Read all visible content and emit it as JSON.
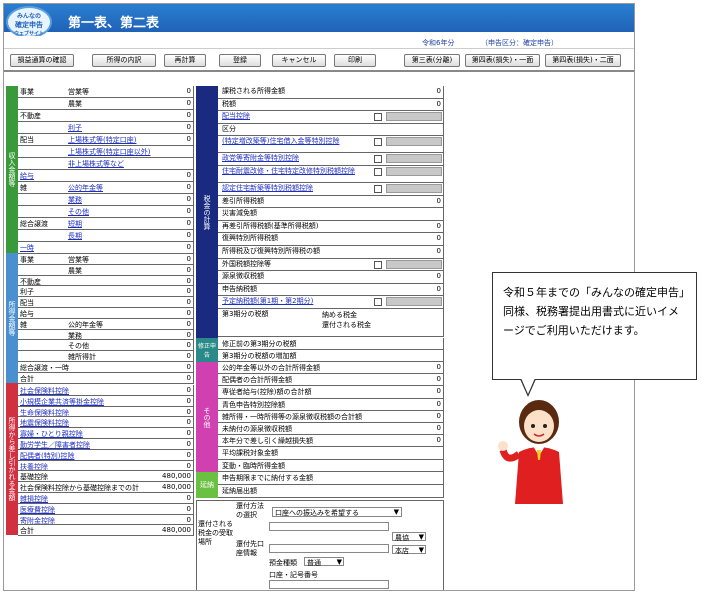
{
  "app": {
    "logo_line1": "みんなの",
    "logo_line2": "確定申告",
    "logo_line3": "ウェブサイト",
    "title": "第一表、第二表",
    "era": "令和6年分",
    "kubun": "（申告区分：確定申告）"
  },
  "toolbar": [
    "損益通算の確認",
    "所得の内訳",
    "再計算",
    "登録",
    "キャンセル",
    "印刷"
  ],
  "toolbar_right": [
    "第三表(分離)",
    "第四表(損失)・一面",
    "第四表(損失)・二面"
  ],
  "categories": {
    "income": "収入金額等",
    "shotoku": "所得金額等",
    "deduct": "所得から差し引かれる金額",
    "tax": "税金の計算",
    "shusei": "修正申告",
    "sonota": "その他",
    "enno": "延納"
  },
  "left_rows": [
    {
      "g": "事業",
      "l": "営業等",
      "v": "0"
    },
    {
      "g": "",
      "l": "農業",
      "v": "0"
    },
    {
      "g": "不動産",
      "l": "",
      "v": "0"
    },
    {
      "g": "",
      "l": "利子",
      "v": "0",
      "link": true
    },
    {
      "g": "配当",
      "l": "上場株式等(特定口座)",
      "v": "0",
      "link": true
    },
    {
      "g": "",
      "l": "上場株式等(特定口座以外)",
      "v": "",
      "link": true
    },
    {
      "g": "",
      "l": "非上場株式等など",
      "v": "",
      "link": true
    },
    {
      "g": "給与",
      "l": "",
      "v": "0",
      "link": true
    },
    {
      "g": "雑",
      "l": "公的年金等",
      "v": "0",
      "link": true
    },
    {
      "g": "",
      "l": "業務",
      "v": "0",
      "link": true
    },
    {
      "g": "",
      "l": "その他",
      "v": "0",
      "link": true
    },
    {
      "g": "総合譲渡",
      "l": "短期",
      "v": "0",
      "link": true
    },
    {
      "g": "",
      "l": "長期",
      "v": "0",
      "link": true
    },
    {
      "g": "一時",
      "l": "",
      "v": "0",
      "link": true
    }
  ],
  "left_rows2": [
    {
      "g": "事業",
      "l": "営業等",
      "v": "0"
    },
    {
      "g": "",
      "l": "農業",
      "v": "0"
    },
    {
      "g": "不動産",
      "l": "",
      "v": "0"
    },
    {
      "g": "利子",
      "l": "",
      "v": "0"
    },
    {
      "g": "配当",
      "l": "",
      "v": "0"
    },
    {
      "g": "給与",
      "l": "",
      "v": "0"
    },
    {
      "g": "雑",
      "l": "公的年金等",
      "v": "0"
    },
    {
      "g": "",
      "l": "業務",
      "v": "0"
    },
    {
      "g": "",
      "l": "その他",
      "v": "0"
    },
    {
      "g": "",
      "l": "雑所得計",
      "v": "0"
    },
    {
      "g": "総合譲渡・一時",
      "l": "",
      "v": "0"
    },
    {
      "g": "合計",
      "l": "",
      "v": "0"
    }
  ],
  "deduct_rows": [
    {
      "l": "社会保険料控除",
      "v": "0"
    },
    {
      "l": "小規模企業共済等掛金控除",
      "v": "0"
    },
    {
      "l": "生命保険料控除",
      "v": "0"
    },
    {
      "l": "地震保険料控除",
      "v": "0"
    },
    {
      "l": "寡婦・ひとり親控除",
      "v": "0"
    },
    {
      "l": "勤労学生／障害者控除",
      "v": "0"
    },
    {
      "l": "配偶者(特別)控除",
      "v": "0"
    },
    {
      "l": "扶養控除",
      "v": "0"
    },
    {
      "l": "基礎控除",
      "v": "480,000"
    },
    {
      "l": "社会保険料控除から基礎控除までの計",
      "v": "480,000"
    },
    {
      "l": "雑損控除",
      "v": "0"
    },
    {
      "l": "医療費控除",
      "v": "0"
    },
    {
      "l": "寄附金控除",
      "v": "0"
    },
    {
      "l": "合計",
      "v": "480,000"
    }
  ],
  "tax_rows": [
    {
      "l": "課税される所得金額",
      "v": "0"
    },
    {
      "l": "税額",
      "v": "0"
    },
    {
      "l": "配当控除",
      "v": "0"
    },
    {
      "l": "区分",
      "v": ""
    },
    {
      "l": "(特定増改築等)住宅借入金等特別控除",
      "v": ""
    },
    {
      "l": "政党等寄附金等特別控除",
      "v": ""
    },
    {
      "l": "住宅耐震改修・住宅特定改修特別税額控除",
      "v": ""
    },
    {
      "l": "認定住宅新築等特別税額控除",
      "v": ""
    },
    {
      "l": "差引所得税額",
      "v": "0"
    },
    {
      "l": "災害減免額",
      "v": ""
    },
    {
      "l": "再差引所得税額(基準所得税額)",
      "v": "0"
    },
    {
      "l": "復興特別所得税額",
      "v": "0"
    },
    {
      "l": "所得税及び復興特別所得税の額",
      "v": "0"
    },
    {
      "l": "外国税額控除等",
      "v": ""
    },
    {
      "l": "源泉徴収税額",
      "v": "0"
    },
    {
      "l": "申告納税額",
      "v": "0"
    },
    {
      "l": "予定納税額(第1期・第2期分)",
      "v": ""
    },
    {
      "l": "第3期分の税額",
      "v": ""
    }
  ],
  "nofu": "納める税金",
  "kanpu": "還付される税金",
  "shusei_rows": [
    {
      "l": "修正前の第3期分の税額",
      "v": ""
    },
    {
      "l": "第3期分の税額の増加額",
      "v": ""
    }
  ],
  "sonota_rows": [
    {
      "l": "公的年金等以外の合計所得金額",
      "v": "0"
    },
    {
      "l": "配偶者の合計所得金額",
      "v": "0"
    },
    {
      "l": "専従者給与(控除)額の合計額",
      "v": "0"
    },
    {
      "l": "青色申告特別控除額",
      "v": "0"
    },
    {
      "l": "雑所得・一時所得等の源泉徴収税額の合計額",
      "v": "0"
    },
    {
      "l": "未納付の源泉徴収税額",
      "v": "0"
    },
    {
      "l": "本年分で差し引く繰越損失額",
      "v": "0"
    },
    {
      "l": "平均課税対象金額",
      "v": ""
    },
    {
      "l": "変動・臨時所得金額",
      "v": ""
    }
  ],
  "enno_rows": [
    {
      "l": "申告期限までに納付する金額",
      "v": ""
    },
    {
      "l": "延納届出額",
      "v": ""
    }
  ],
  "refund": {
    "label": "還付される税金の受取場所",
    "place_label": "還付方法の選択",
    "place_value": "口座への振込みを希望する",
    "bank_label": "還付先口座情報",
    "bank_type": "農協",
    "branch": "本店",
    "acct_type_label": "預金種類",
    "acct_type": "普通",
    "acct_no_label": "口座・記号番号"
  },
  "callout": "令和５年までの「みんなの確定申告」同様、税務署提出用書式に近いイメージでご利用いただけます。"
}
